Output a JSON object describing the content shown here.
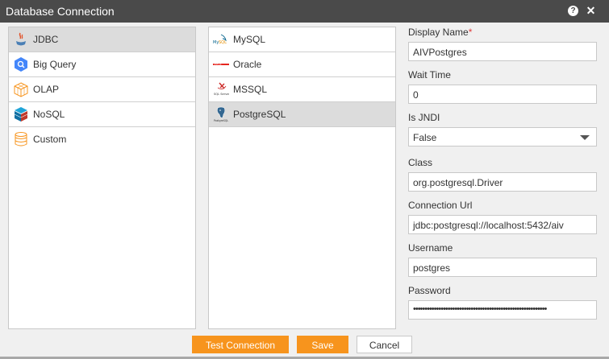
{
  "window": {
    "title": "Database Connection",
    "help_glyph": "?",
    "close_glyph": "✕"
  },
  "categories": [
    {
      "label": "JDBC",
      "icon": "jdbc-icon",
      "selected": true
    },
    {
      "label": "Big Query",
      "icon": "bigquery-icon",
      "selected": false
    },
    {
      "label": "OLAP",
      "icon": "olap-cube-icon",
      "selected": false
    },
    {
      "label": "NoSQL",
      "icon": "nosql-icon",
      "selected": false
    },
    {
      "label": "Custom",
      "icon": "database-icon",
      "selected": false
    }
  ],
  "drivers": [
    {
      "label": "MySQL",
      "icon": "mysql-logo-icon",
      "selected": false
    },
    {
      "label": "Oracle",
      "icon": "oracle-logo-icon",
      "selected": false
    },
    {
      "label": "MSSQL",
      "icon": "mssql-logo-icon",
      "selected": false
    },
    {
      "label": "PostgreSQL",
      "icon": "postgresql-logo-icon",
      "selected": true
    }
  ],
  "form": {
    "display_name": {
      "label": "Display Name",
      "required_mark": "*",
      "value": "AIVPostgres"
    },
    "wait_time": {
      "label": "Wait Time",
      "value": "0"
    },
    "is_jndi": {
      "label": "Is JNDI",
      "value": "False"
    },
    "class": {
      "label": "Class",
      "value": "org.postgresql.Driver"
    },
    "connection_url": {
      "label": "Connection Url",
      "value": "jdbc:postgresql://localhost:5432/aiv"
    },
    "username": {
      "label": "Username",
      "value": "postgres"
    },
    "password": {
      "label": "Password",
      "value": "••••••••••••••••••••••••••••••••••••••••••••••••••••••••••"
    }
  },
  "buttons": {
    "test": "Test Connection",
    "save": "Save",
    "cancel": "Cancel"
  },
  "colors": {
    "accent": "#f7941d",
    "titlebar": "#4a4a4a",
    "required": "#e03c3c"
  }
}
